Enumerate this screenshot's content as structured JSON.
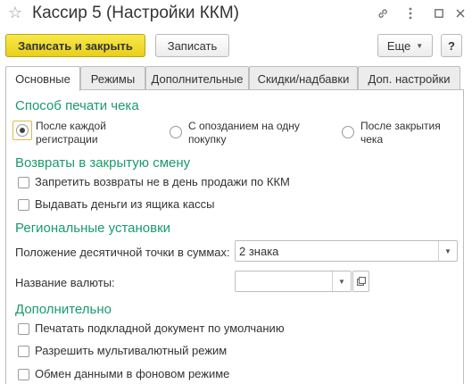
{
  "window": {
    "title": "Кассир 5 (Настройки ККМ)"
  },
  "toolbar": {
    "save_close": "Записать и закрыть",
    "save": "Записать",
    "more": "Еще"
  },
  "tabs": [
    "Основные",
    "Режимы",
    "Дополнительные",
    "Скидки/надбавки",
    "Доп. настройки"
  ],
  "print_method": {
    "title": "Способ печати чека",
    "options": [
      {
        "line1": "После каждой",
        "line2": "регистрации",
        "selected": true
      },
      {
        "line1": "С опозданием на одну",
        "line2": "покупку",
        "selected": false
      },
      {
        "line1": "После закрытия",
        "line2": "чека",
        "selected": false
      }
    ]
  },
  "returns": {
    "title": "Возвраты в закрытую смену",
    "items": [
      "Запретить возвраты не в день продажи по ККМ",
      "Выдавать деньги из ящика кассы"
    ]
  },
  "regional": {
    "title": "Региональные установки",
    "decimal_label": "Положение десятичной точки в суммах:",
    "decimal_value": "2 знака",
    "currency_label": "Название валюты:",
    "currency_value": ""
  },
  "additional": {
    "title": "Дополнительно",
    "items": [
      "Печатать подкладной документ по умолчанию",
      "Разрешить мультивалютный режим",
      "Обмен данными в фоновом режиме"
    ]
  }
}
